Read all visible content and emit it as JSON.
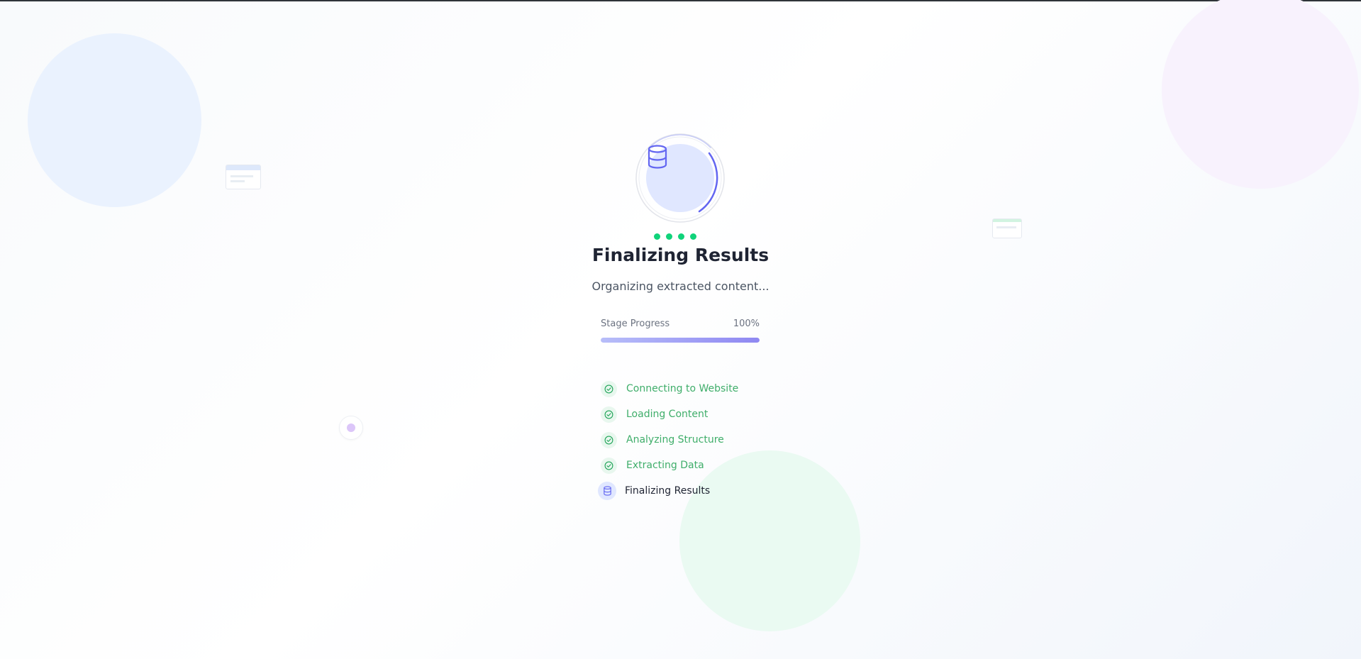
{
  "loader": {
    "status_icon": "database-icon",
    "accent_color": "#6366f1",
    "dots_color": "#10d37a"
  },
  "header": {
    "title": "Finalizing Results",
    "subtitle": "Organizing extracted content..."
  },
  "progress": {
    "label": "Stage Progress",
    "percent_text": "100%",
    "value": 1.0
  },
  "steps": [
    {
      "label": "Connecting to Website",
      "status": "done",
      "icon": "check-circle-icon"
    },
    {
      "label": "Loading Content",
      "status": "done",
      "icon": "check-circle-icon"
    },
    {
      "label": "Analyzing Structure",
      "status": "done",
      "icon": "check-circle-icon"
    },
    {
      "label": "Extracting Data",
      "status": "done",
      "icon": "check-circle-icon"
    },
    {
      "label": "Finalizing Results",
      "status": "current",
      "icon": "database-icon"
    }
  ]
}
